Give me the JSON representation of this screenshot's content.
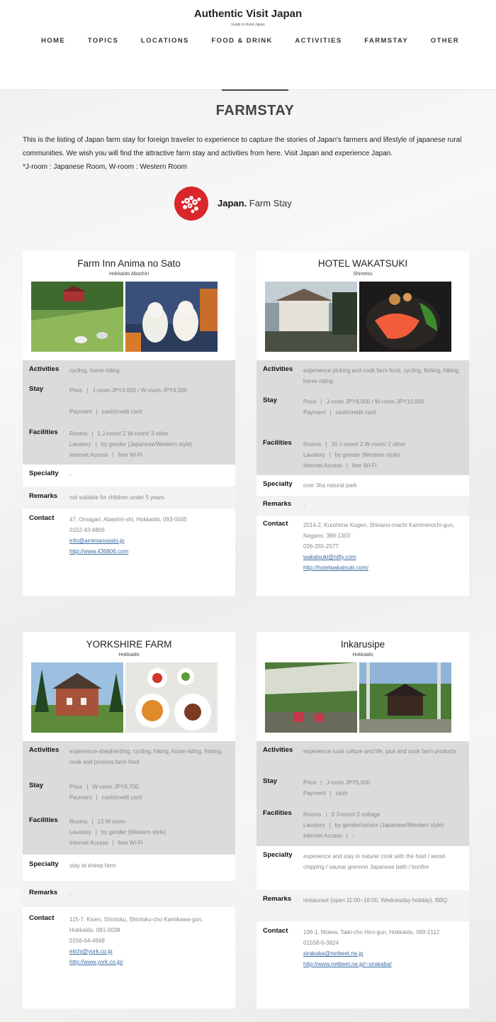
{
  "site": {
    "title": "Authentic Visit Japan",
    "subtitle": "Guide to Rural Japan"
  },
  "nav": [
    "HOME",
    "TOPICS",
    "LOCATIONS",
    "FOOD & DRINK",
    "ACTIVITIES",
    "FARMSTAY",
    "OTHER"
  ],
  "page": {
    "title": "FARMSTAY",
    "intro_1": "This is the listing of Japan farm stay for foreign traveler to experience to capture the stories of Japan's farmers and lifestyle of japanese rural communities. We wish you will find the attractive farm stay and activities from here. Visit Japan and experience Japan.",
    "intro_2": "*J-room : Japanese Room, W-room : Western Room",
    "logo_bold": "Japan.",
    "logo_rest": " Farm Stay"
  },
  "labels": {
    "activities": "Activities",
    "stay": "Stay",
    "facilities": "Facilities",
    "specialty": "Specialty",
    "remarks": "Remarks",
    "contact": "Contact",
    "price": "Price",
    "payment": "Payment",
    "rooms": "Rooms",
    "lavatory": "Lavatory",
    "internet": "Internet Access",
    "bar": "|"
  },
  "cards": [
    {
      "name": "Farm Inn Anima no Sato",
      "location": "Hokkaido Abashiri",
      "activities": "cycling, horse riding",
      "price": "J-room JPY4,000 / W-room JPY4,000",
      "payment": "cash/credit card",
      "rooms": "1 J-room/ 2 W-room/ 3 other",
      "lavatory": "by gender (Japanese/Western style)",
      "internet": "free Wi-Fi",
      "specialty": "-",
      "remarks": "not suitable for children under 5 years",
      "address": "47, Omagari, Abashiri-shi, Hokkaido, 093-0045",
      "tel": "0152-43-6806",
      "email": "info@amimanosato.jp",
      "url": "http://www.436806.com"
    },
    {
      "name": "HOTEL WAKATSUKI",
      "location": "Shinetsu",
      "activities": "experience picking and cook farm food, cycling, fishing, hiking, horse riding",
      "price": "J-room JPY8,000 / W-room JPY10,000",
      "payment": "cash/credit card",
      "rooms": "30 J-room/ 2 W-room/ 2 other",
      "lavatory": "by gender (Western style)",
      "internet": "free Wi-Fi",
      "specialty": "over 3ha natural park",
      "remarks": "-",
      "address": "2014-2, Kurohime Kogen, Shinano-machi Kamiminochi-gun, Nagano, 389-1303",
      "tel": "026-255-2577",
      "email": "wakatsuki@nifty.com",
      "url": "http://hotelwakatsuki.com/"
    },
    {
      "name": "YORKSHIRE FARM",
      "location": "Hokkaido",
      "activities": "experience shepherding, cycling, hiking, horse riding, fishing, cook and process farm food",
      "price": "W-room JPY6,700",
      "payment": "cash/credit card",
      "rooms": "13 W-room",
      "lavatory": "by gender (Western style)",
      "internet": "free Wi-Fi",
      "specialty": "stay at sheep farm",
      "remarks": "-",
      "address": "115-7, Kisen, Shintoku, Shintoku-cho Kamikawa-gun, Hokkaido, 081-0038",
      "tel": "0156-64-4948",
      "email": "eiichi@york.co.jp",
      "url": "http://www.york.co.jp/"
    },
    {
      "name": "Inkarusipe",
      "location": "Hokkaido",
      "activities": "experience rural culture and life, pick and cook farm products",
      "price": "J-room JPY5,000",
      "payment": "cash",
      "rooms": "3 J-room/ 2 cottage",
      "lavatory": "by gender/unisex (Japanese/Western style)",
      "internet": "-",
      "specialty": "experience and stay in nature/ cook with the host / wood-chipping / sauna/ goemon Japanese bath / bonfire",
      "remarks": "restaurant (open 11:00~18:00, Wednesday holiday), BBQ",
      "address": "106-1, Moiwa, Taiki-cho Hiro-gun, Hokkaido, 089-2112",
      "tel": "01558-6-3824",
      "email": "sirakaba@netbeet.ne.jp",
      "url": "http://www.netbeet.ne.jp/~sirakaba/"
    }
  ],
  "colors": {
    "logo_red": "#d9262b",
    "info_grey": "#d9dcd9",
    "link": "#3b6aa3"
  }
}
